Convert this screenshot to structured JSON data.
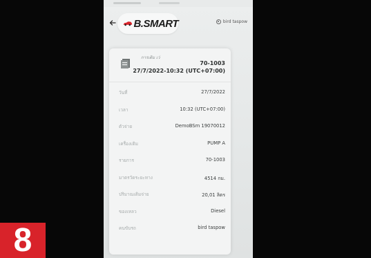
{
  "header": {
    "brand": "B.SMART",
    "user_name": "bird taspow",
    "back_icon": "arrow-left-icon",
    "user_icon": "user-circle-icon",
    "brand_color": "#d8232a"
  },
  "card": {
    "type_label": "การเติม เว่",
    "code": "70-1003",
    "datetime": "27/7/2022-10:32 (UTC+07:00)",
    "icon": "receipt-icon",
    "rows": [
      {
        "label": "วันที่",
        "value": "27/7/2022"
      },
      {
        "label": "เวลา",
        "value": "10:32 (UTC+07:00)"
      },
      {
        "label": "ตัวจ่าย",
        "value": "DemoBSm 19070012"
      },
      {
        "label": "เครื่องเติม",
        "value": "PUMP A"
      },
      {
        "label": "รายการ",
        "value": "70-1003"
      },
      {
        "label": "มาตรวัดระยะทาง",
        "value": "4514 กม."
      },
      {
        "label": "ปริมาณเติมจ่าย",
        "value": "20,01 ลิตร"
      },
      {
        "label": "ของเหลว",
        "value": "Diesel"
      },
      {
        "label": "คนขับรถ",
        "value": "bird taspow"
      }
    ]
  },
  "step_badge": {
    "number": "8",
    "color": "#d8232a"
  }
}
